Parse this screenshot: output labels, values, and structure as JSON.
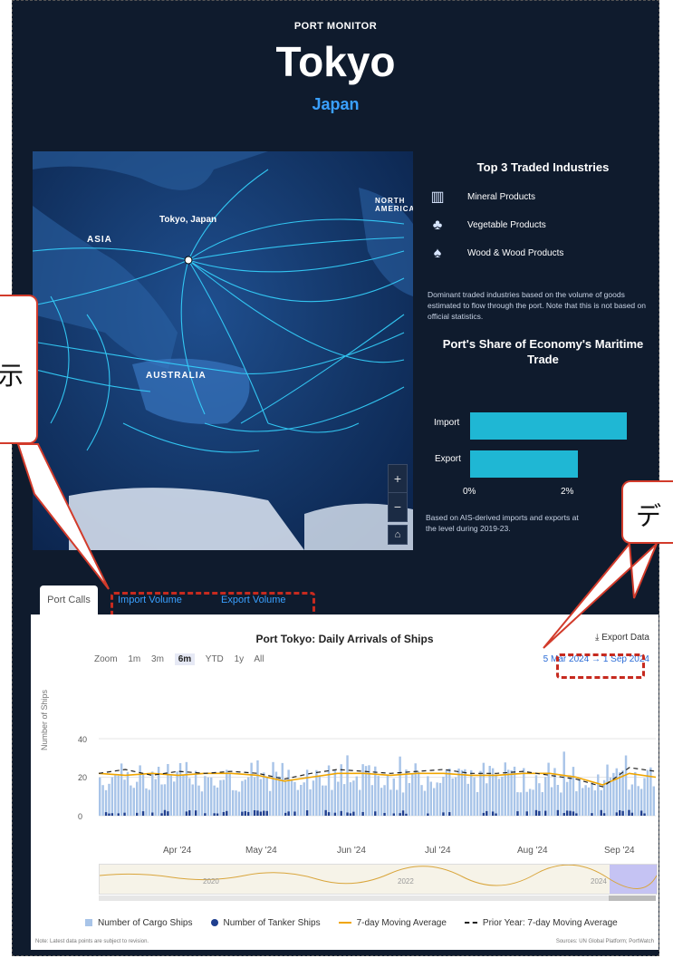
{
  "header": {
    "eyebrow": "PORT MONITOR",
    "city": "Tokyo",
    "country": "Japan"
  },
  "map": {
    "port_label": "Tokyo, Japan",
    "region_labels": [
      "ASIA",
      "NORTH AMERICA",
      "AUSTRALIA"
    ],
    "zoom_in": "+",
    "zoom_out": "−",
    "home_icon": "home-icon"
  },
  "industries": {
    "title": "Top 3 Traded Industries",
    "items": [
      {
        "label": "Mineral Products",
        "icon": "building-icon"
      },
      {
        "label": "Vegetable Products",
        "icon": "vegetable-icon"
      },
      {
        "label": "Wood & Wood Products",
        "icon": "tree-icon"
      }
    ],
    "note": "Dominant traded industries based on the volume of goods estimated to flow through the port. Note that this is not based on official statistics."
  },
  "share": {
    "title": "Port's Share of Economy's Maritime Trade",
    "bars": [
      {
        "label": "Import",
        "value": 3.2
      },
      {
        "label": "Export",
        "value": 2.2
      }
    ],
    "ticks": [
      "0%",
      "2%"
    ],
    "note": "Based on AIS-derived imports and exports at the level during 2019-23."
  },
  "callouts": {
    "left_fragment": "示",
    "right_fragment": "デ"
  },
  "tabs": [
    "Port Calls",
    "Import Volume",
    "Export Volume"
  ],
  "active_tab": "Port Calls",
  "chart_data": {
    "type": "bar",
    "title": "Port Tokyo: Daily Arrivals of Ships",
    "ylabel": "Number of Ships",
    "ylim": [
      0,
      40
    ],
    "yticks": [
      "0",
      "20",
      "40"
    ],
    "xticks": [
      "Apr '24",
      "May '24",
      "Jun '24",
      "Jul '24",
      "Aug '24",
      "Sep '24"
    ],
    "navigator_labels": [
      "2020",
      "2022",
      "2024"
    ],
    "series": [
      {
        "name": "Number of Cargo Ships",
        "color": "#a8c4e8"
      },
      {
        "name": "Number of Tanker Ships",
        "color": "#1f3f8f"
      },
      {
        "name": "7-day Moving Average",
        "color": "#f0a500",
        "values": [
          22,
          21,
          22,
          21,
          22,
          22,
          21,
          18,
          20,
          22,
          22,
          21,
          22,
          22,
          21,
          21,
          22,
          22,
          20,
          16,
          22,
          20
        ]
      },
      {
        "name": "Prior Year: 7-day Moving Average",
        "color": "#222222",
        "values": [
          22,
          24,
          21,
          23,
          22,
          23,
          22,
          19,
          22,
          24,
          23,
          22,
          23,
          24,
          22,
          22,
          23,
          21,
          19,
          15,
          25,
          23
        ]
      }
    ]
  },
  "chart_ui": {
    "zoom_label": "Zoom",
    "zoom_options": [
      "1m",
      "3m",
      "6m",
      "YTD",
      "1y",
      "All"
    ],
    "selected_zoom": "6m",
    "export_label": "Export Data",
    "range_start": "5 Mar 2024",
    "range_arrow": "→",
    "range_end": "1 Sep 2024"
  },
  "footer": {
    "note": "Note: Latest data points are subject to revision.",
    "sources": "Sources: UN Global Platform; PortWatch"
  }
}
